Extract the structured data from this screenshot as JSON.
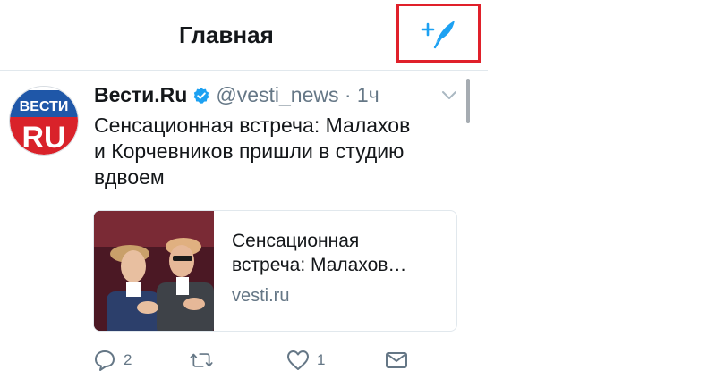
{
  "header": {
    "title": "Главная"
  },
  "tweet": {
    "author": "Вести.Ru",
    "handle": "@vesti_news",
    "separator": " · ",
    "time": "1ч",
    "text_line1": "Сенсационная встреча:  Малахов",
    "text_line2": "и Корчевников пришли в студию",
    "text_line3": "вдвоем",
    "avatar_text_top": "ВЕСТИ",
    "avatar_text_bottom": "RU"
  },
  "card": {
    "title_line1": "Сенсационная",
    "title_line2": "встреча: Малахов…",
    "domain": "vesti.ru"
  },
  "actions": {
    "reply_count": "2",
    "like_count": "1"
  },
  "colors": {
    "accent": "#1da1f2",
    "highlight": "#e0202a",
    "secondary_text": "#657786"
  },
  "icons": [
    "compose-tweet-icon",
    "verified-icon",
    "chevron-down-icon",
    "reply-icon",
    "retweet-icon",
    "like-icon",
    "direct-message-icon"
  ]
}
